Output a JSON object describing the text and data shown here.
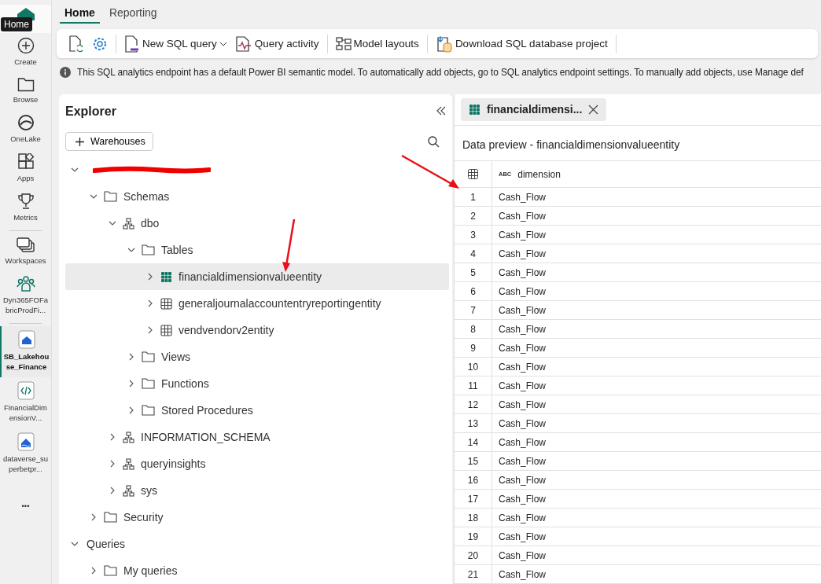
{
  "rail": {
    "tooltip": "Home",
    "items": [
      {
        "kind": "home",
        "selected": false
      },
      {
        "kind": "create",
        "label": "Create",
        "selected": false
      },
      {
        "kind": "browse",
        "label": "Browse",
        "selected": false
      },
      {
        "kind": "onelake",
        "label": "OneLake",
        "selected": false
      },
      {
        "kind": "apps",
        "label": "Apps",
        "selected": false
      },
      {
        "kind": "metrics",
        "label": "Metrics",
        "selected": false
      },
      {
        "kind": "divider"
      },
      {
        "kind": "workspaces",
        "label": "Workspaces",
        "selected": false
      },
      {
        "kind": "workspace",
        "label": "Dyn365FOFabricProdFi...",
        "selected": false
      },
      {
        "kind": "divider"
      },
      {
        "kind": "lakehouse",
        "label": "SB_Lakehouse_Finance",
        "selected": true
      },
      {
        "kind": "notebook",
        "label": "FinancialDimensionV...",
        "selected": false
      },
      {
        "kind": "dataverse",
        "label": "dataverse_superbetpr...",
        "selected": false
      },
      {
        "kind": "more",
        "label": "•••",
        "selected": false
      }
    ]
  },
  "tabs": [
    {
      "label": "Home",
      "selected": true
    },
    {
      "label": "Reporting",
      "selected": false
    }
  ],
  "toolbar": [
    {
      "kind": "refresh"
    },
    {
      "kind": "settings"
    },
    {
      "kind": "sep"
    },
    {
      "kind": "newsql",
      "label": "New SQL query",
      "dropdown": true
    },
    {
      "kind": "activity",
      "label": "Query activity"
    },
    {
      "kind": "sep"
    },
    {
      "kind": "layouts",
      "label": "Model layouts"
    },
    {
      "kind": "sep"
    },
    {
      "kind": "download",
      "label": "Download SQL database project"
    },
    {
      "kind": "sep"
    }
  ],
  "info_bar": {
    "text": "This SQL analytics endpoint has a default Power BI semantic model. To automatically add objects, go to SQL analytics endpoint settings. To manually add objects, use Manage def"
  },
  "explorer": {
    "title": "Explorer",
    "add_button": "Warehouses",
    "tree": [
      {
        "kind": "redacted",
        "expanded": true,
        "children": [
          {
            "kind": "folder",
            "label": "Schemas",
            "expanded": true,
            "children": [
              {
                "kind": "schema",
                "label": "dbo",
                "expanded": true,
                "children": [
                  {
                    "kind": "folder",
                    "label": "Tables",
                    "expanded": true,
                    "children": [
                      {
                        "kind": "table",
                        "label": "financialdimensionvalueentity",
                        "expanded": false,
                        "selected": true
                      },
                      {
                        "kind": "table",
                        "label": "generaljournalaccountentryreportingentity",
                        "expanded": false,
                        "selected": false
                      },
                      {
                        "kind": "table",
                        "label": "vendvendorv2entity",
                        "expanded": false,
                        "selected": false
                      }
                    ]
                  },
                  {
                    "kind": "folder",
                    "label": "Views",
                    "expanded": false
                  },
                  {
                    "kind": "folder",
                    "label": "Functions",
                    "expanded": false
                  },
                  {
                    "kind": "folder",
                    "label": "Stored Procedures",
                    "expanded": false
                  }
                ]
              },
              {
                "kind": "schema",
                "label": "INFORMATION_SCHEMA",
                "expanded": false
              },
              {
                "kind": "schema",
                "label": "queryinsights",
                "expanded": false
              },
              {
                "kind": "schema",
                "label": "sys",
                "expanded": false
              }
            ]
          },
          {
            "kind": "folder",
            "label": "Security",
            "expanded": false
          }
        ]
      },
      {
        "kind": "plain",
        "label": "Queries",
        "expanded": true,
        "children": [
          {
            "kind": "folder",
            "label": "My queries",
            "expanded": false
          }
        ]
      }
    ]
  },
  "editor_tab": {
    "label": "financialdimensi..."
  },
  "preview": {
    "title": "Data preview - financialdimensionvalueentity",
    "column_type": "ABC",
    "column": "dimension",
    "rows": [
      [
        "1",
        "Cash_Flow"
      ],
      [
        "2",
        "Cash_Flow"
      ],
      [
        "3",
        "Cash_Flow"
      ],
      [
        "4",
        "Cash_Flow"
      ],
      [
        "5",
        "Cash_Flow"
      ],
      [
        "6",
        "Cash_Flow"
      ],
      [
        "7",
        "Cash_Flow"
      ],
      [
        "8",
        "Cash_Flow"
      ],
      [
        "9",
        "Cash_Flow"
      ],
      [
        "10",
        "Cash_Flow"
      ],
      [
        "11",
        "Cash_Flow"
      ],
      [
        "12",
        "Cash_Flow"
      ],
      [
        "13",
        "Cash_Flow"
      ],
      [
        "14",
        "Cash_Flow"
      ],
      [
        "15",
        "Cash_Flow"
      ],
      [
        "16",
        "Cash_Flow"
      ],
      [
        "17",
        "Cash_Flow"
      ],
      [
        "18",
        "Cash_Flow"
      ],
      [
        "19",
        "Cash_Flow"
      ],
      [
        "20",
        "Cash_Flow"
      ],
      [
        "21",
        "Cash_Flow"
      ]
    ]
  }
}
